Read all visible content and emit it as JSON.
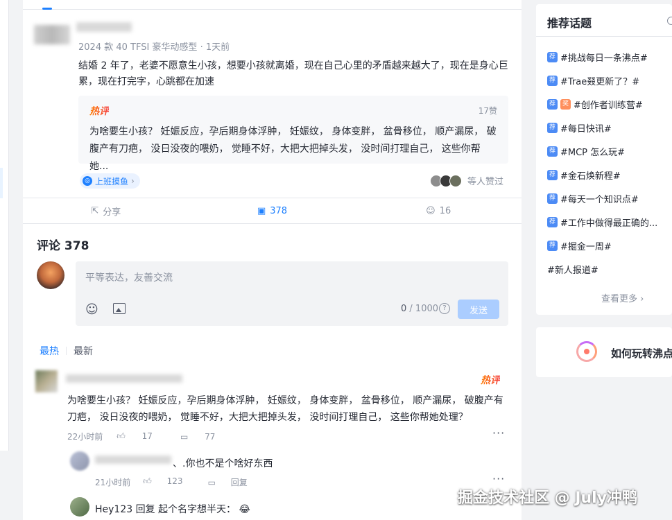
{
  "post": {
    "meta": "2024 款 40 TFSI 豪华动感型 · 1天前",
    "content": "结婚 2 年了，老婆不愿意生小孩，想要小孩就离婚，现在自己心里的矛盾越来越大了，现在是身心巨累，现在打完字，心跳都在加速",
    "hot_comment": {
      "badge": "热评",
      "likes": "17赞",
      "text": "为啥要生小孩？ 妊娠反应，孕后期身体浮肿， 妊娠纹， 身体变胖， 盆骨移位， 顺产漏尿， 破腹产有刀疤， 没日没夜的喂奶， 觉睡不好，大把大把掉头发， 没时间打理自己， 这些你帮她..."
    },
    "topic_tag": "上班摸鱼",
    "likers_text": "等人赞过",
    "actions": {
      "share": "分享",
      "comments": "378",
      "likes": "16"
    }
  },
  "comments": {
    "title": "评论 378",
    "input": {
      "placeholder": "平等表达，友善交流",
      "count_current": "0",
      "count_max": " / 1000",
      "send": "发送"
    },
    "sort": {
      "hot": "最热",
      "new": "最新"
    },
    "items": [
      {
        "hot_badge": "热评",
        "text": "为啥要生小孩？ 妊娠反应，孕后期身体浮肿， 妊娠纹， 身体变胖， 盆骨移位， 顺产漏尿， 破腹产有刀疤， 没日没夜的喂奶， 觉睡不好，大把大把掉头发， 没时间打理自己， 这些你帮她处理？",
        "time": "22小时前",
        "likes": "17",
        "replies": "77",
        "more": "···",
        "sub_replies": [
          {
            "text": "、.你也不是个啥好东西",
            "time": "21小时前",
            "likes": "123",
            "reply": "回复",
            "more": "···"
          },
          {
            "text": "Hey123 回复 起个名字想半天："
          }
        ]
      }
    ]
  },
  "sidebar": {
    "recommend_title": "推荐话题",
    "badge_rec": "荐",
    "badge_prize": "奖",
    "topics": [
      "#挑战每日一条沸点#",
      "#Trae叕更新了？#",
      "#创作者训练营#",
      "#每日快讯#",
      "#MCP 怎么玩#",
      "#金石焕新程#",
      "#每天一个知识点#",
      "#工作中做得最正确的...",
      "#掘金一周#",
      "#新人报道#"
    ],
    "see_more": "查看更多 ›",
    "guide_text": "如何玩转沸点"
  },
  "watermark": "掘金技术社区 @ July冲鸭",
  "colors": {
    "accent": "#1e80ff",
    "hot": "#f53f3f",
    "text": "#252933",
    "muted": "#8a919f",
    "background": "#f2f3f5"
  }
}
